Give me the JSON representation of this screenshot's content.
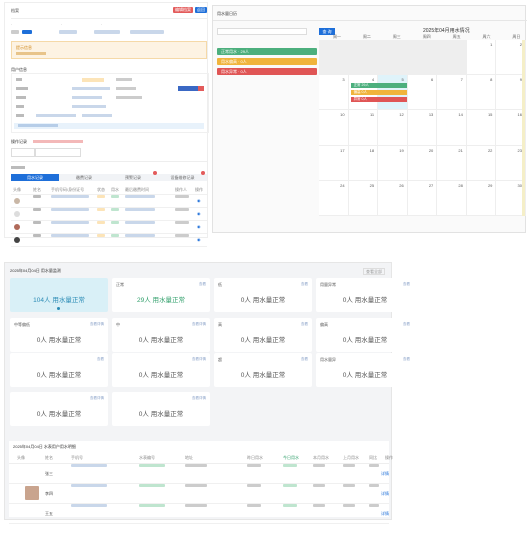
{
  "left": {
    "header_title": "档案",
    "btn_red": "编辑档案",
    "btn_blue": "返回",
    "table_header": [
      "头像",
      "姓名",
      "手机号码/身份证号",
      "状态",
      "用水",
      "最后缴费时间",
      "操作人",
      "操作"
    ],
    "tabs": [
      "用水记录",
      "缴费记录",
      "预警记录",
      "设备维修记录"
    ],
    "notice_title": "提示信息",
    "section_info": "用户信息",
    "section_record": "操作记录"
  },
  "calendar": {
    "panel_title": "用水量日历",
    "search_button": "查 询",
    "title": "2025年04月用水情况",
    "weekdays": [
      "周一",
      "周二",
      "周三",
      "周四",
      "周五",
      "周六",
      "周日"
    ],
    "side_events": [
      {
        "label": "正常用水 · 29人",
        "color": "#4caf7d"
      },
      {
        "label": "用水偏高 · 0人",
        "color": "#f0b43c"
      },
      {
        "label": "用水异常 · 0人",
        "color": "#e05555"
      }
    ],
    "days": [
      "",
      "",
      "",
      "",
      "",
      "1",
      "2",
      "3",
      "4",
      "5",
      "6",
      "7",
      "8",
      "9",
      "10",
      "11",
      "12",
      "13",
      "14",
      "15",
      "16",
      "17",
      "18",
      "19",
      "20",
      "21",
      "22",
      "23",
      "24",
      "25",
      "26",
      "27",
      "28",
      "29",
      "30"
    ],
    "cell_events": [
      {
        "label": "正常 29人",
        "color": "#4caf7d"
      },
      {
        "label": "偏高 0人",
        "color": "#f0b43c"
      },
      {
        "label": "异常 0人",
        "color": "#e05555"
      }
    ]
  },
  "bottom": {
    "title": "2025年04月04日 用水量监测",
    "more": "查看全部",
    "cards": [
      {
        "label": "",
        "link": "",
        "value": "104人 用水量正常",
        "style": "hl"
      },
      {
        "label": "正常",
        "link": "查看",
        "value": "29人 用水量正常",
        "style": "green"
      },
      {
        "label": "低",
        "link": "查看",
        "value": "0人 用水量正常",
        "style": ""
      },
      {
        "label": "用量异常",
        "link": "查看",
        "value": "0人 用水量正常",
        "style": ""
      },
      {
        "label": "中等偏低",
        "link": "查看详情",
        "value": "0人 用水量正常",
        "style": ""
      },
      {
        "label": "中",
        "link": "查看详情",
        "value": "0人 用水量正常",
        "style": ""
      },
      {
        "label": "高",
        "link": "查看",
        "value": "0人 用水量正常",
        "style": ""
      },
      {
        "label": "偏高",
        "link": "查看",
        "value": "0人 用水量正常",
        "style": ""
      },
      {
        "label": "",
        "link": "查看",
        "value": "0人 用水量正常",
        "style": ""
      },
      {
        "label": "",
        "link": "查看详情",
        "value": "0人 用水量正常",
        "style": ""
      },
      {
        "label": "超",
        "link": "查看",
        "value": "0人 用水量正常",
        "style": ""
      },
      {
        "label": "用水量异",
        "link": "查看",
        "value": "0人 用水量正常",
        "style": ""
      },
      {
        "label": "",
        "link": "查看详情",
        "value": "0人 用水量正常",
        "style": ""
      },
      {
        "label": "",
        "link": "查看详情",
        "value": "0人 用水量正常",
        "style": ""
      }
    ],
    "table_title": "2025年04月04日 水表用户用水明细",
    "table_header": [
      "头像",
      "姓名",
      "手机号",
      "水表编号",
      "地址",
      "昨日用水",
      "今日用水",
      "本月用水",
      "上月用水",
      "同比",
      "操作"
    ],
    "rows": [
      {
        "name": "张三",
        "link": "详情"
      },
      {
        "name": "李四",
        "link": "详情"
      },
      {
        "name": "王五",
        "link": "详情"
      }
    ]
  }
}
